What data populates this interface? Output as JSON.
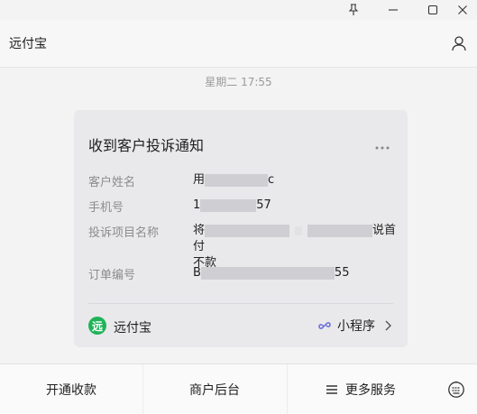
{
  "app_title": "远付宝",
  "timestamp": "星期二 17:55",
  "card": {
    "title": "收到客户投诉通知",
    "fields": [
      {
        "label": "客户姓名",
        "value_prefix": "用",
        "value_suffix": "c"
      },
      {
        "label": "手机号",
        "value_prefix": "1",
        "value_suffix": "57"
      },
      {
        "label": "投诉项目名称",
        "value_prefix": "将",
        "value_suffix": "说首付",
        "value_line2": "不款"
      },
      {
        "label": "订单编号",
        "value_prefix": "B",
        "value_suffix": "55"
      }
    ],
    "footer": {
      "brand_logo_char": "远",
      "brand_name": "远付宝",
      "miniprogram_label": "小程序"
    }
  },
  "bottom_menu": {
    "item1": "开通收款",
    "item2": "商户后台",
    "item3": "更多服务"
  },
  "icons": {
    "pin": "pin-icon",
    "minimize": "minimize-icon",
    "maximize": "maximize-icon",
    "close": "close-icon",
    "profile": "profile-icon",
    "more": "more-dots-icon",
    "link": "link-icon",
    "chevron": "chevron-right-icon",
    "menu": "menu-lines-icon",
    "keyboard": "keyboard-icon"
  },
  "colors": {
    "brand_green": "#1fb35a",
    "miniprogram_accent": "#6b6fd8"
  }
}
